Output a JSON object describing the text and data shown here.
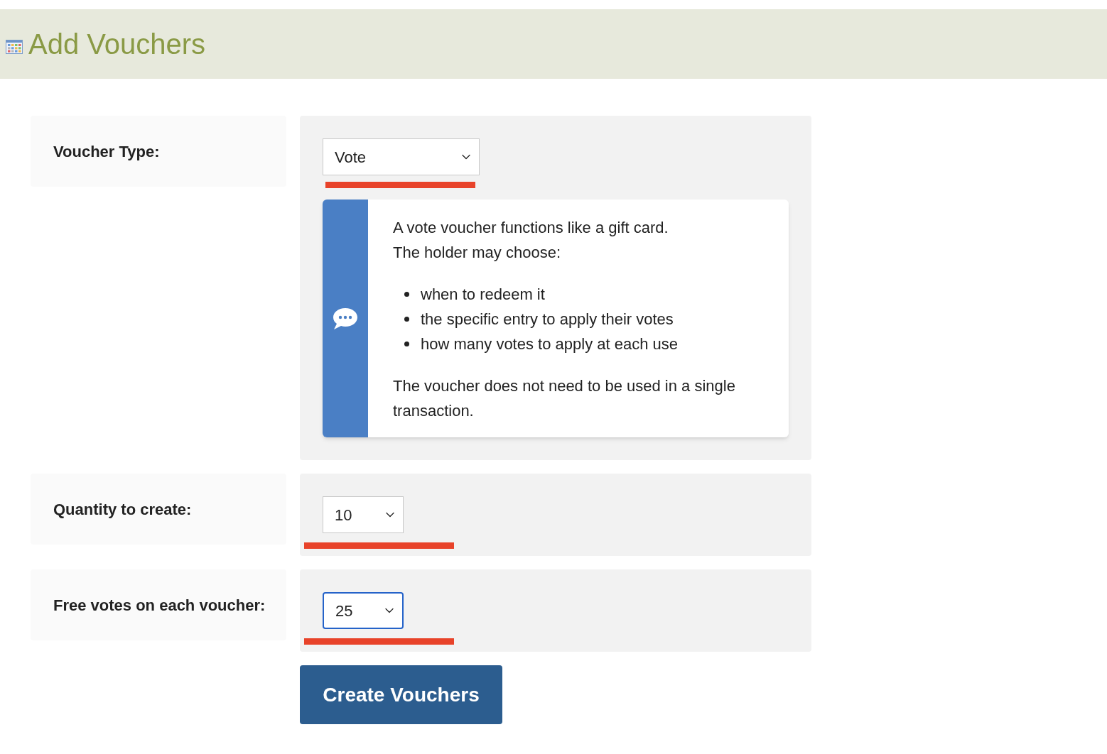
{
  "header": {
    "title": "Add Vouchers"
  },
  "fields": [
    {
      "label": "Voucher Type:",
      "value": "Vote",
      "focused": false,
      "underlined": true,
      "kind": "choice",
      "info": {
        "lines": [
          "A vote voucher functions like a gift card.",
          "The holder may choose:"
        ],
        "bullets": [
          "when to redeem it",
          "the specific entry to apply their votes",
          "how many votes to apply at each use"
        ],
        "footer": "The voucher does not need to be used in a single transaction."
      }
    },
    {
      "label": "Quantity to create:",
      "value": "10",
      "focused": false,
      "underlined": true,
      "kind": "number"
    },
    {
      "label": "Free votes on each voucher:",
      "value": "25",
      "focused": true,
      "underlined": true,
      "kind": "number"
    }
  ],
  "submit": {
    "label": "Create Vouchers"
  }
}
